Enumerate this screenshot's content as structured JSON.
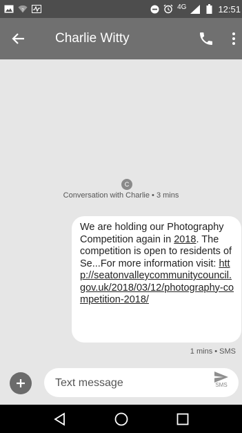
{
  "status_bar": {
    "network_label": "4G",
    "time": "12:51",
    "left_icons": [
      "image-icon",
      "wifi-question-icon",
      "activity-icon"
    ],
    "right_icons": [
      "dnd-icon",
      "alarm-icon",
      "signal-icon",
      "battery-icon"
    ]
  },
  "app_bar": {
    "title": "Charlie Witty",
    "icons": [
      "back-arrow-icon",
      "phone-icon",
      "more-vertical-icon"
    ]
  },
  "conversation": {
    "avatar_letter": "C",
    "info": "Conversation with Charlie • 3 mins"
  },
  "message": {
    "text_before_year": "We are holding our Photography Competition again in ",
    "year": "2018",
    "text_after_year": ". The competition is open to residents of Se...For more information visit: ",
    "url": "http://seatonvalleycommunitycouncil.gov.uk/2018/03/12/photography-competition-2018/",
    "meta": "1 mins • SMS"
  },
  "composer": {
    "placeholder": "Text message",
    "send_label": "SMS"
  },
  "colors": {
    "status_bar": "#4d4d4d",
    "app_bar": "#707070",
    "background": "#e6e6e6",
    "bubble": "#ffffff",
    "nav_bar": "#000000"
  }
}
